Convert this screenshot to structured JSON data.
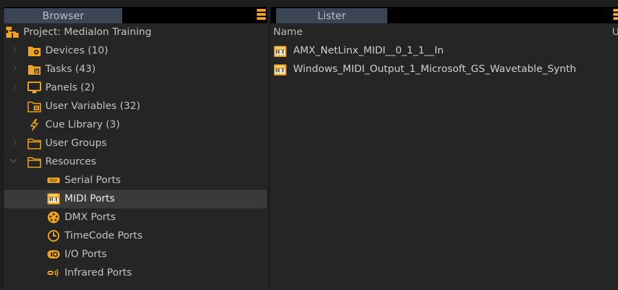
{
  "browser": {
    "tab_label": "Browser",
    "items": [
      {
        "label": "Project: Medialon Training",
        "icon": "project-icon",
        "indent": 0,
        "expander": "none"
      },
      {
        "label": "Devices (10)",
        "icon": "devices-folder-icon",
        "indent": 1,
        "expander": "collapsed"
      },
      {
        "label": "Tasks (43)",
        "icon": "tasks-folder-icon",
        "indent": 1,
        "expander": "collapsed"
      },
      {
        "label": "Panels (2)",
        "icon": "monitor-icon",
        "indent": 1,
        "expander": "collapsed"
      },
      {
        "label": "User Variables (32)",
        "icon": "variables-folder-icon",
        "indent": 1,
        "expander": "none"
      },
      {
        "label": "Cue Library (3)",
        "icon": "lightning-icon",
        "indent": 1,
        "expander": "none"
      },
      {
        "label": "User Groups",
        "icon": "folder-icon",
        "indent": 1,
        "expander": "collapsed"
      },
      {
        "label": "Resources",
        "icon": "folder-icon",
        "indent": 1,
        "expander": "expanded"
      },
      {
        "label": "Serial Ports",
        "icon": "serial-port-icon",
        "indent": 2,
        "expander": "none"
      },
      {
        "label": "MIDI Ports",
        "icon": "midi-port-icon",
        "indent": 2,
        "expander": "none",
        "selected": true
      },
      {
        "label": "DMX Ports",
        "icon": "dmx-port-icon",
        "indent": 2,
        "expander": "none"
      },
      {
        "label": "TimeCode Ports",
        "icon": "timecode-port-icon",
        "indent": 2,
        "expander": "none"
      },
      {
        "label": "I/O Ports",
        "icon": "io-port-icon",
        "indent": 2,
        "expander": "none"
      },
      {
        "label": "Infrared Ports",
        "icon": "infrared-port-icon",
        "indent": 2,
        "expander": "none"
      }
    ]
  },
  "lister": {
    "tab_label": "Lister",
    "column_name": "Name",
    "column_truncated": "U",
    "rows": [
      {
        "label": "AMX_NetLinx_MIDI__0_1_1__In",
        "icon": "midi-port-icon"
      },
      {
        "label": "Windows_MIDI_Output_1_Microsoft_GS_Wavetable_Synth",
        "icon": "midi-port-icon"
      }
    ]
  },
  "colors": {
    "accent": "#f0a418",
    "tab_bg": "#3a4656",
    "panel_bg": "#252525",
    "selected_bg": "#3a3a3a"
  }
}
